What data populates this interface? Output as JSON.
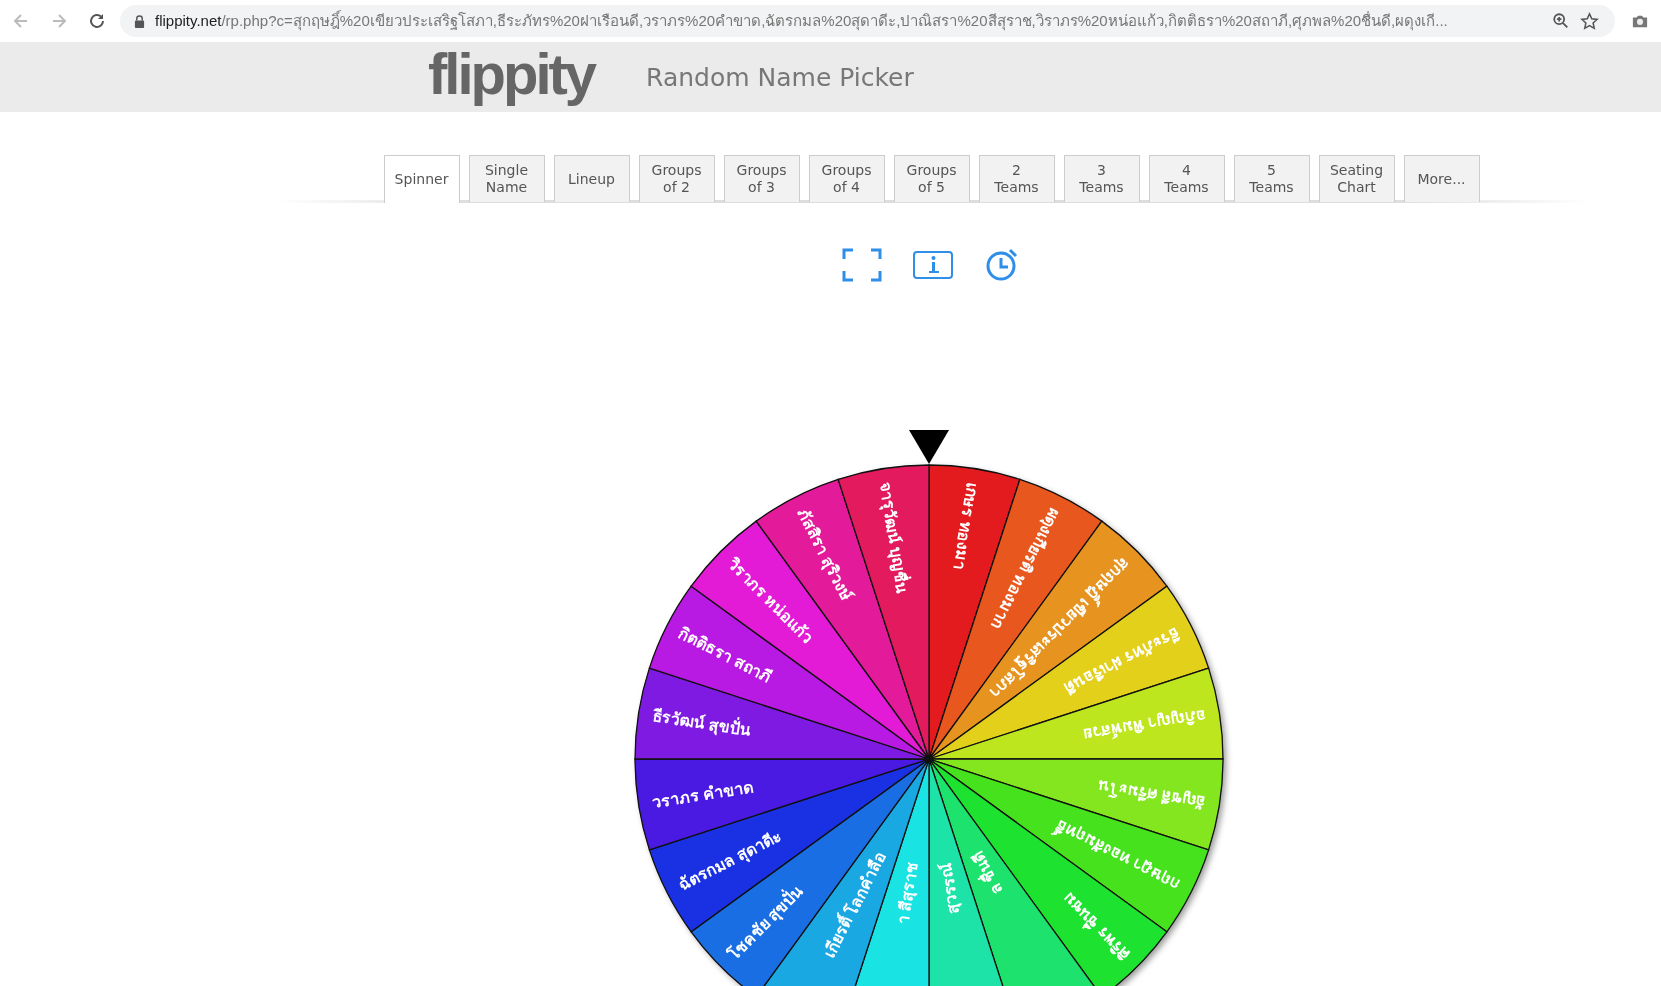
{
  "browser": {
    "host": "flippity.net",
    "path": "/rp.php?c=สุกฤษฎิ์%20เขียวประเสริฐโสภา,ธีระภัทร%20ฝาเรือนดี,วราภร%20คำขาด,ฉัตรกมล%20สุดาดีะ,ปาณิสรา%20สีสุราช,วิราภร%20หน่อแก้ว,กิตติธรา%20สถาภี,ศุภพล%20ชื่นดี,ผดุงเกี..."
  },
  "header": {
    "logo": "flippity",
    "title": "Random Name Picker"
  },
  "tabs": [
    {
      "label": "Spinner",
      "selected": true
    },
    {
      "label": "Single\nName",
      "selected": false
    },
    {
      "label": "Lineup",
      "selected": false
    },
    {
      "label": "Groups\nof 2",
      "selected": false
    },
    {
      "label": "Groups\nof 3",
      "selected": false
    },
    {
      "label": "Groups\nof 4",
      "selected": false
    },
    {
      "label": "Groups\nof 5",
      "selected": false
    },
    {
      "label": "2\nTeams",
      "selected": false
    },
    {
      "label": "3\nTeams",
      "selected": false
    },
    {
      "label": "4\nTeams",
      "selected": false
    },
    {
      "label": "5\nTeams",
      "selected": false
    },
    {
      "label": "Seating\nChart",
      "selected": false
    },
    {
      "label": "More...",
      "selected": false
    }
  ],
  "wheel": {
    "segments": [
      {
        "name": "เกษร ทองมา",
        "color": "#e41b1e",
        "cut": false
      },
      {
        "name": "ผดุงเกียรติ ทองมาก",
        "color": "#e8571e",
        "cut": false
      },
      {
        "name": "สุกฤษฎิ์ เขียวประเสริฐโสภา",
        "color": "#e6941f",
        "cut": false
      },
      {
        "name": "ธีระภัทร ฝาเรือนดี",
        "color": "#e3d01b",
        "cut": false
      },
      {
        "name": "อภิญญา พิมพ์สวย",
        "color": "#bee61e",
        "cut": false
      },
      {
        "name": "อัญชลี ศรีมะโน",
        "color": "#84e61e",
        "cut": false
      },
      {
        "name": "กฤษฎา ทองสัมฤทธิ์",
        "color": "#46e21e",
        "cut": false
      },
      {
        "name": "ศิริพร ชื่นชม",
        "color": "#1de22f",
        "cut": false
      },
      {
        "name": "ล ชื่นดี",
        "color": "#1de26e",
        "cut": true
      },
      {
        "name": "สุวรรณ์",
        "color": "#1ee3a8",
        "cut": true
      },
      {
        "name": "า สีสุราช",
        "color": "#1ae3e3",
        "cut": true
      },
      {
        "name": "เกียรติ์ โลกคำลือ",
        "color": "#1aa8e3",
        "cut": true
      },
      {
        "name": "โชคชัย สุขปั่น",
        "color": "#1a6ee3",
        "cut": false
      },
      {
        "name": "ฉัตรกมล สุดาดีะ",
        "color": "#1a30e3",
        "cut": false
      },
      {
        "name": "วราภร คำขาด",
        "color": "#4a1ae3",
        "cut": false
      },
      {
        "name": "ธีรวัฒน์ สุขปั่น",
        "color": "#7f1ae3",
        "cut": false
      },
      {
        "name": "กิตติธรา สถาภี",
        "color": "#b81ae3",
        "cut": false
      },
      {
        "name": "วิราภร หน่อแก้ว",
        "color": "#e31ad6",
        "cut": false
      },
      {
        "name": "ภัสสิรา สุริวงษ์",
        "color": "#e31a99",
        "cut": false
      },
      {
        "name": "จารุวัฒน์ บุญชื่น",
        "color": "#e31a5e",
        "cut": false
      }
    ]
  }
}
